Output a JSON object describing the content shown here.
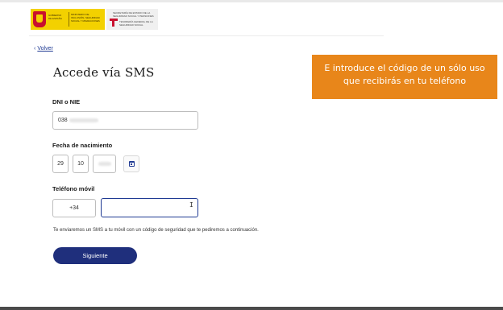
{
  "header": {
    "gov_text": "GOBIERNO DE ESPAÑA",
    "ministry_text": "MINISTERIO DE INCLUSIÓN, SEGURIDAD SOCIAL Y MIGRACIONES",
    "secretary_text": "SECRETARÍA DE ESTADO DE LA SEGURIDAD SOCIAL Y PENSIONES",
    "treasury_text": "TESORERÍA GENERAL DE LA SEGURIDAD SOCIAL"
  },
  "nav": {
    "back_label": "Volver"
  },
  "form": {
    "title": "Accede vía SMS",
    "dni_label": "DNI o NIE",
    "dni_value": "038",
    "birth_label": "Fecha de nacimiento",
    "birth_day": "29",
    "birth_month": "10",
    "phone_label": "Teléfono móvil",
    "phone_prefix": "+34",
    "phone_value": "",
    "note": "Te enviaremos un SMS a tu móvil con un código de seguridad que te pediremos a continuación.",
    "submit_label": "Siguiente"
  },
  "banner": {
    "text": "E introduce el código de un sólo uso que recibirás en tu teléfono",
    "color": "#e8861a"
  },
  "colors": {
    "primary": "#1f2f7c",
    "link": "#1f3a93",
    "gov_yellow": "#f3d100",
    "gov_red": "#c8102e"
  }
}
